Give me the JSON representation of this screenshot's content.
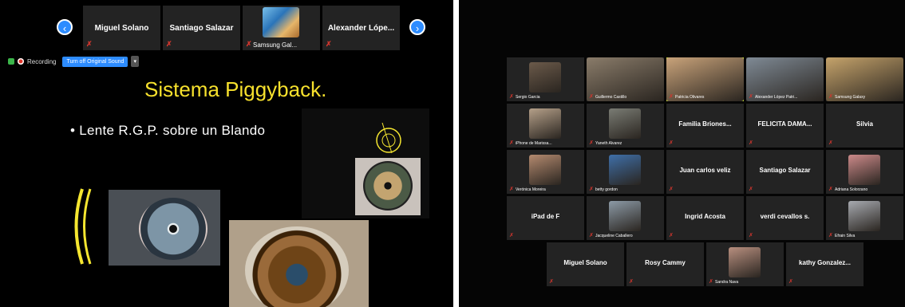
{
  "strip": {
    "tiles": [
      {
        "name": "Miguel Solano"
      },
      {
        "name": "Santiago Salazar"
      },
      {
        "name": "Samsung Gal..."
      },
      {
        "name": "Alexander Lópe..."
      }
    ]
  },
  "recording": {
    "label": "Recording",
    "sound_button": "Turn off Original Sound",
    "caret": "▾"
  },
  "slide": {
    "title": "Sistema Piggyback.",
    "bullet": "• Lente R.G.P. sobre un Blando"
  },
  "grid": {
    "rows": [
      [
        {
          "name": "Sergio Garcia",
          "type": "video",
          "color": "#6b5a4a"
        },
        {
          "name": "Guillermo Castillo",
          "type": "video",
          "color": "#8a7c6a"
        },
        {
          "name": "Patricia Olivares",
          "type": "video",
          "color": "#c9a37a",
          "highlight": true
        },
        {
          "name": "Alexander López Patri...",
          "type": "video",
          "color": "#7f8a95"
        },
        {
          "name": "Samsung Galaxy",
          "type": "video",
          "color": "#c5a36b"
        }
      ],
      [
        {
          "name": "iPhone de Marissa...",
          "type": "video",
          "color": "#b5a089"
        },
        {
          "name": "Yaneth Alvarez",
          "type": "video",
          "color": "#7a7c74"
        },
        {
          "name": "Familia Briones...",
          "type": "text"
        },
        {
          "name": "FELICITA DAMA...",
          "type": "text"
        },
        {
          "name": "Silvia",
          "type": "text"
        }
      ],
      [
        {
          "name": "Verónica Moreira",
          "type": "video",
          "color": "#b48a6f"
        },
        {
          "name": "betty gordon",
          "type": "video",
          "color": "#3f6fa8"
        },
        {
          "name": "Juan carlos veliz",
          "type": "text"
        },
        {
          "name": "Santiago Salazar",
          "type": "text"
        },
        {
          "name": "Adriana Solorzano",
          "type": "video",
          "color": "#cc8a8a"
        }
      ],
      [
        {
          "name": "iPad de F",
          "type": "text"
        },
        {
          "name": "Jacqueline Caballero",
          "type": "video",
          "color": "#8c9aa6"
        },
        {
          "name": "Ingrid Acosta",
          "type": "text"
        },
        {
          "name": "verdi cevallos s.",
          "type": "text"
        },
        {
          "name": "Efrain Silva",
          "type": "video",
          "color": "#a7aab0"
        }
      ],
      [
        {
          "name": "Miguel Solano",
          "type": "text"
        },
        {
          "name": "Rosy Cammy",
          "type": "text"
        },
        {
          "name": "Sandra Nava",
          "type": "video",
          "color": "#b88f7f"
        },
        {
          "name": "kathy Gonzalez...",
          "type": "text"
        }
      ]
    ]
  },
  "colors": {
    "accent": "#2d8cff",
    "slide_title": "#f7e12d",
    "tile_bg": "#232323",
    "muted_mic": "#d0362e"
  }
}
